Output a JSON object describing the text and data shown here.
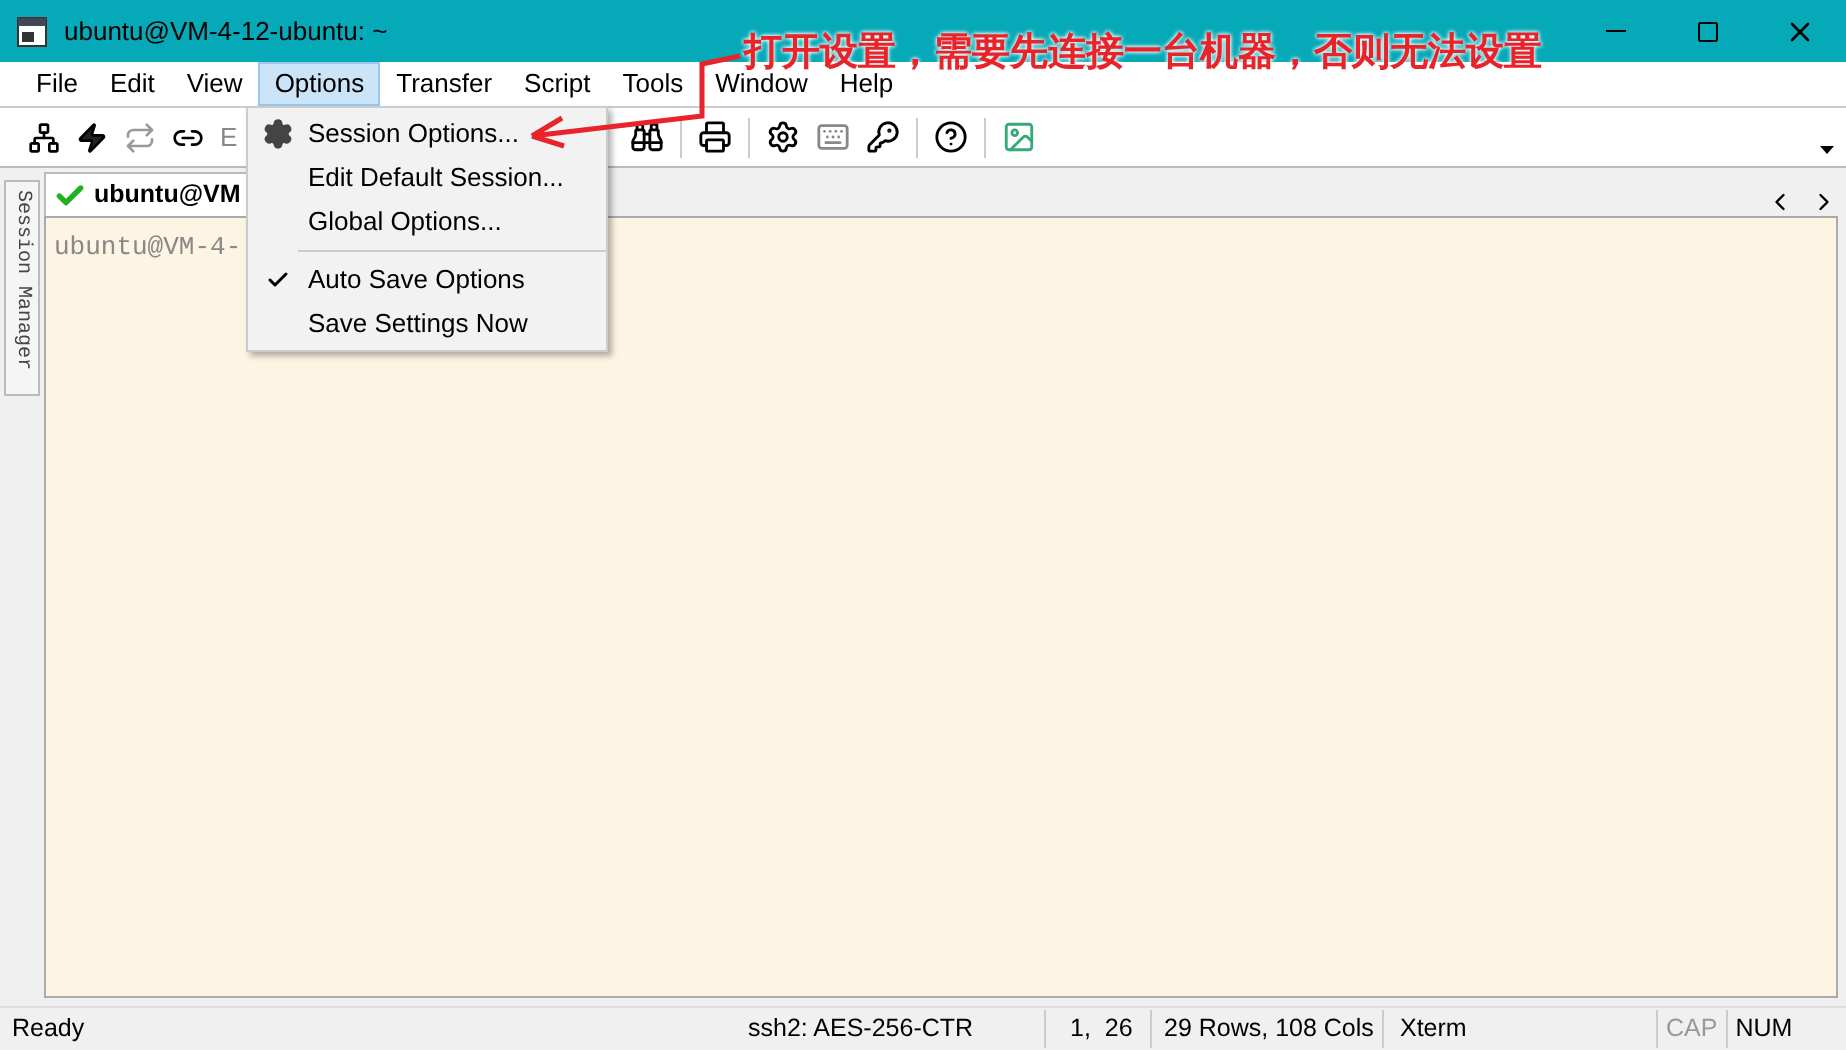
{
  "window": {
    "title": "ubuntu@VM-4-12-ubuntu: ~"
  },
  "menu_bar": [
    {
      "label": "File",
      "selected": false
    },
    {
      "label": "Edit",
      "selected": false
    },
    {
      "label": "View",
      "selected": false
    },
    {
      "label": "Options",
      "selected": true
    },
    {
      "label": "Transfer",
      "selected": false
    },
    {
      "label": "Script",
      "selected": false
    },
    {
      "label": "Tools",
      "selected": false
    },
    {
      "label": "Window",
      "selected": false
    },
    {
      "label": "Help",
      "selected": false
    }
  ],
  "toolbar": {
    "partial_label": "E"
  },
  "options_menu": [
    {
      "label": "Session Options...",
      "kind": "icon"
    },
    {
      "label": "Edit Default Session...",
      "kind": "item",
      "checked": false
    },
    {
      "label": "Global Options...",
      "kind": "item",
      "checked": false
    },
    {
      "kind": "separator"
    },
    {
      "label": "Auto Save Options",
      "kind": "item",
      "checked": true
    },
    {
      "label": "Save Settings Now",
      "kind": "item",
      "checked": false
    }
  ],
  "session_manager": {
    "label": "Session Manager"
  },
  "tab": {
    "label": "ubuntu@VM",
    "connected": true
  },
  "terminal": {
    "text": "ubuntu@VM-4-"
  },
  "annotation": {
    "text": "打开设置，需要先连接一台机器，否则无法设置"
  },
  "status_bar": {
    "left": "Ready",
    "cipher": "ssh2: AES-256-CTR",
    "position": "1,  26",
    "size": "29 Rows, 108 Cols",
    "terminal_type": "Xterm",
    "indicators": [
      {
        "label": "CAP",
        "on": false
      },
      {
        "label": "NUM",
        "on": true
      }
    ]
  }
}
